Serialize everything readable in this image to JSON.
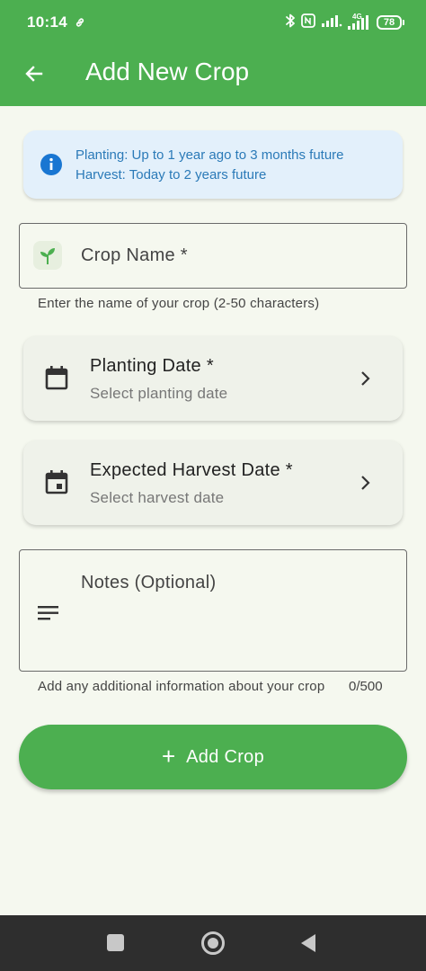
{
  "status_bar": {
    "time": "10:14",
    "network_label": "4G",
    "battery": "78",
    "icons": [
      "link-icon",
      "bluetooth-icon",
      "nfc-icon",
      "signal-icon",
      "signal-4g-icon",
      "battery-icon"
    ]
  },
  "app_bar": {
    "title": "Add New Crop",
    "back_icon": "arrow-left-icon"
  },
  "info_banner": {
    "line1": "Planting: Up to 1 year ago to 3 months future",
    "line2": "Harvest: Today to 2 years future",
    "icon": "info-icon"
  },
  "crop_name": {
    "label": "Crop Name *",
    "helper": "Enter the name of your crop (2-50 characters)",
    "icon": "sprout-icon"
  },
  "planting_date": {
    "label": "Planting Date *",
    "placeholder": "Select planting date",
    "icon": "calendar-icon"
  },
  "harvest_date": {
    "label": "Expected Harvest Date *",
    "placeholder": "Select harvest date",
    "icon": "calendar-event-icon"
  },
  "notes": {
    "label": "Notes (Optional)",
    "helper": "Add any additional information about your crop",
    "counter": "0/500",
    "icon": "notes-icon"
  },
  "submit": {
    "label": "Add Crop",
    "icon_text": "+"
  },
  "colors": {
    "primary": "#4caf50",
    "background": "#f5f8ef",
    "info_bg": "#e3f0fb",
    "info_text": "#2b7ab8",
    "info_icon": "#1976d2"
  }
}
